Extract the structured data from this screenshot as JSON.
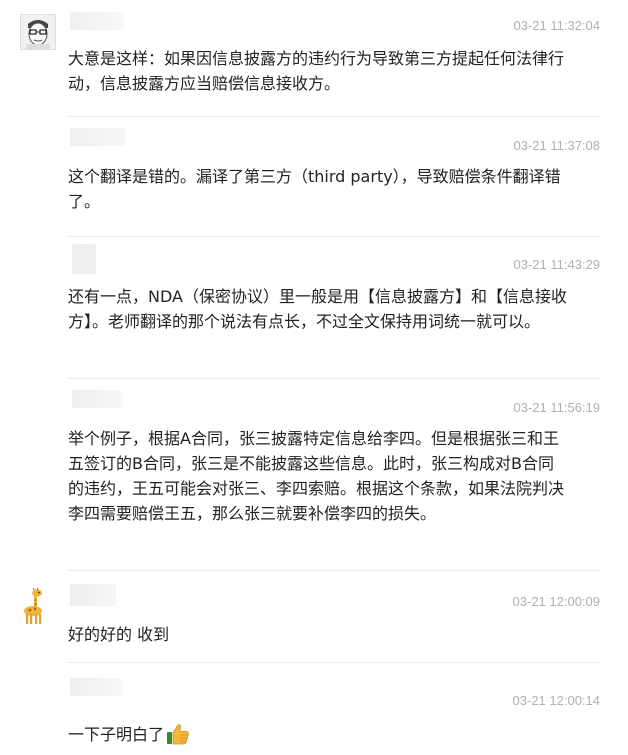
{
  "messages": [
    {
      "time": "03-21 11:32:04",
      "text": "大意是这样：如果因信息披露方的违约行为导致第三方提起任何法律行动，信息披露方应当赔偿信息接收方。",
      "avatar": "cartoon-face-icon"
    },
    {
      "time": "03-21 11:37:08",
      "text": "这个翻译是错的。漏译了第三方（third party），导致赔偿条件翻译错了。",
      "avatar": "none"
    },
    {
      "time": "03-21 11:43:29",
      "text": "还有一点，NDA（保密协议）里一般是用【信息披露方】和【信息接收方】。老师翻译的那个说法有点长，不过全文保持用词统一就可以。",
      "avatar": "none"
    },
    {
      "time": "03-21 11:56:19",
      "text": "举个例子，根据A合同，张三披露特定信息给李四。但是根据张三和王五签订的B合同，张三是不能披露这些信息。此时，张三构成对B合同的违约，王五可能会对张三、李四索赔。根据这个条款，如果法院判决李四需要赔偿王五，那么张三就要补偿李四的损失。",
      "avatar": "none"
    },
    {
      "time": "03-21 12:00:09",
      "text": "好的好的 收到",
      "avatar": "giraffe-icon"
    },
    {
      "time": "03-21 12:00:14",
      "text": "一下子明白了",
      "avatar": "none",
      "emoji": "thumbs-up-icon"
    }
  ]
}
